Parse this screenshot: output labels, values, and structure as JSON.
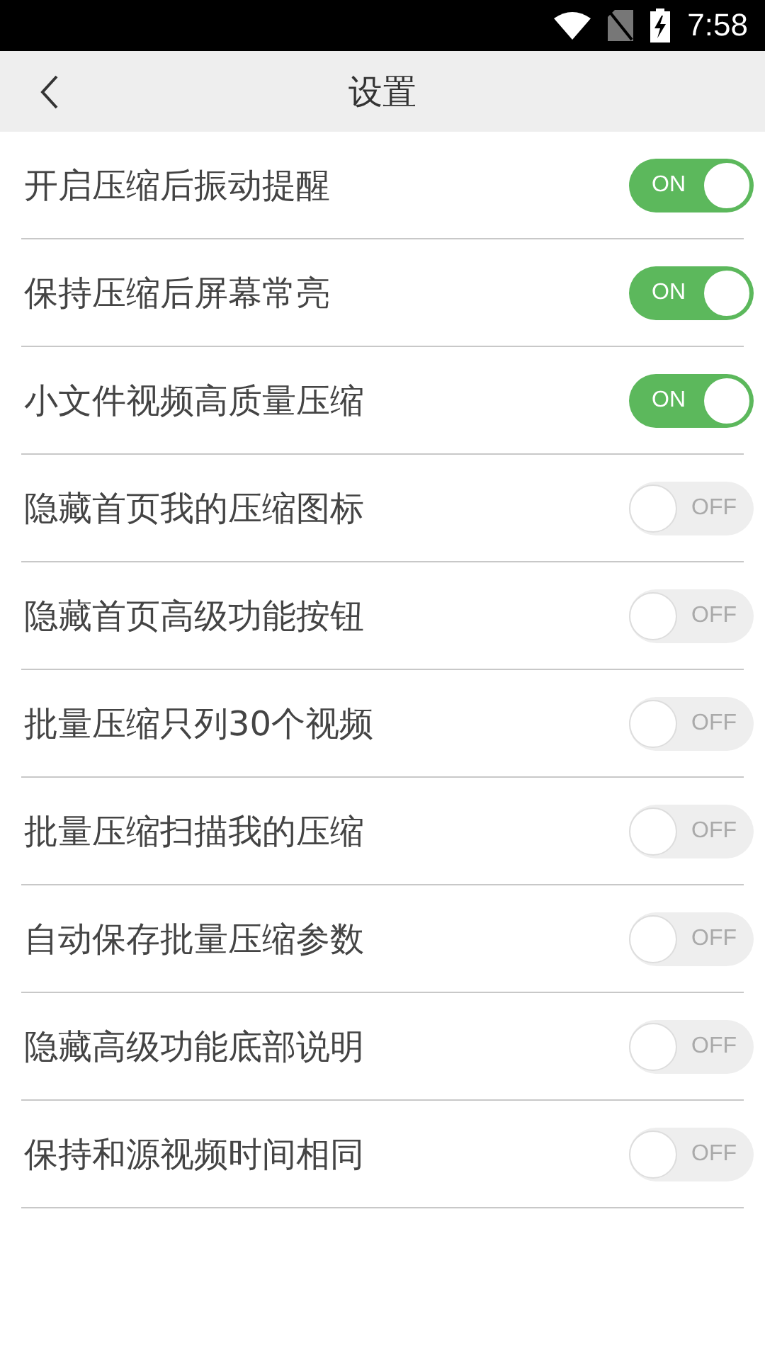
{
  "status_bar": {
    "time": "7:58"
  },
  "header": {
    "title": "设置"
  },
  "settings": [
    {
      "label": "开启压缩后振动提醒",
      "on": true,
      "toggle_text": "ON"
    },
    {
      "label": "保持压缩后屏幕常亮",
      "on": true,
      "toggle_text": "ON"
    },
    {
      "label": "小文件视频高质量压缩",
      "on": true,
      "toggle_text": "ON"
    },
    {
      "label": "隐藏首页我的压缩图标",
      "on": false,
      "toggle_text": "OFF"
    },
    {
      "label": "隐藏首页高级功能按钮",
      "on": false,
      "toggle_text": "OFF"
    },
    {
      "label": "批量压缩只列30个视频",
      "on": false,
      "toggle_text": "OFF"
    },
    {
      "label": "批量压缩扫描我的压缩",
      "on": false,
      "toggle_text": "OFF"
    },
    {
      "label": "自动保存批量压缩参数",
      "on": false,
      "toggle_text": "OFF"
    },
    {
      "label": "隐藏高级功能底部说明",
      "on": false,
      "toggle_text": "OFF"
    },
    {
      "label": "保持和源视频时间相同",
      "on": false,
      "toggle_text": "OFF"
    }
  ]
}
